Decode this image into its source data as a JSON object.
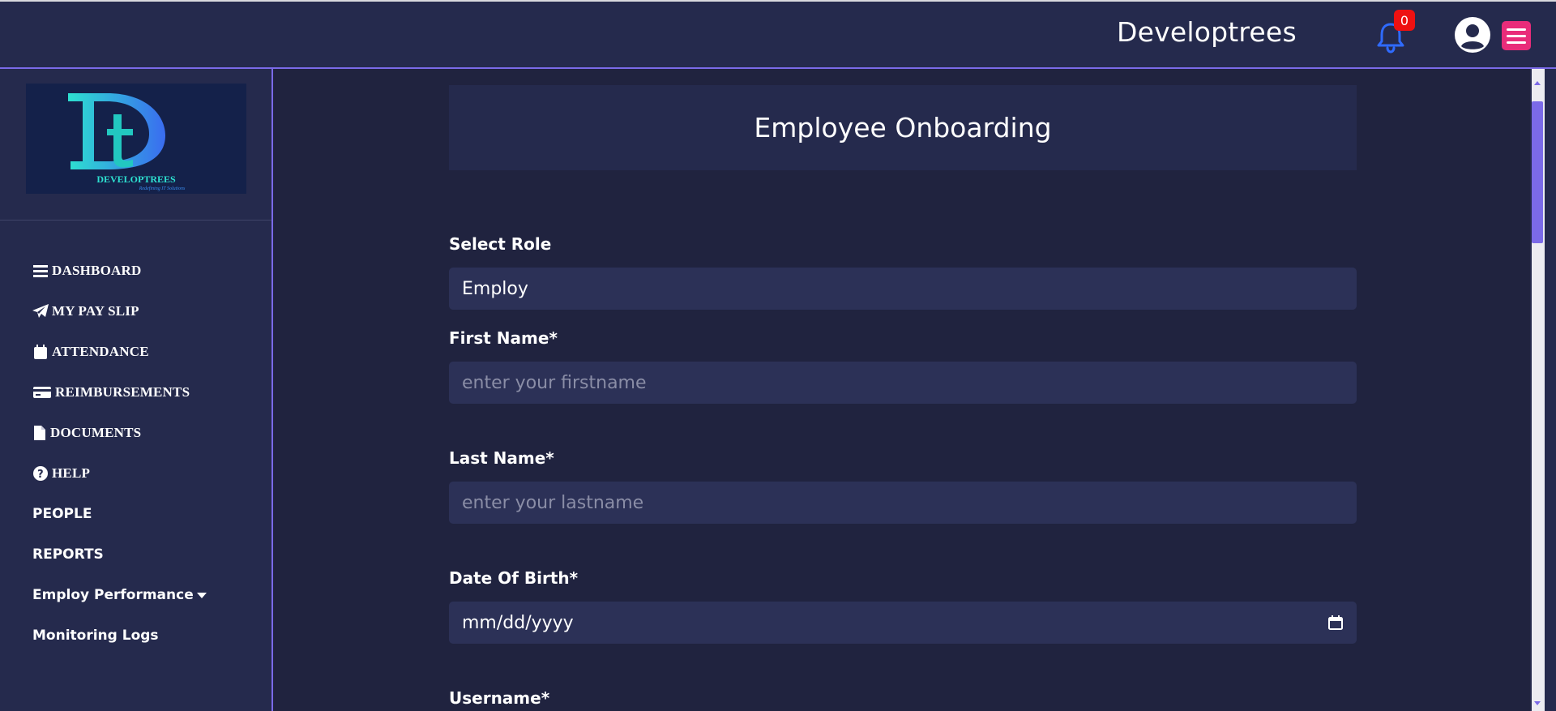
{
  "header": {
    "title": "Developtrees",
    "notification_count": "0",
    "bell_icon": "bell-icon",
    "avatar_icon": "user-circle-icon",
    "menu_icon": "hamburger-icon"
  },
  "logo": {
    "monogram": "Dt",
    "wordmark": "DEVELOPTREES",
    "tagline": "Redefining IT Solutions"
  },
  "sidebar": {
    "items": [
      {
        "label": "DASHBOARD",
        "icon": "bars-icon"
      },
      {
        "label": "MY PAY SLIP",
        "icon": "paper-plane-icon"
      },
      {
        "label": "ATTENDANCE",
        "icon": "calendar-icon"
      },
      {
        "label": "REIMBURSEMENTS",
        "icon": "credit-card-icon"
      },
      {
        "label": "DOCUMENTS",
        "icon": "file-icon"
      },
      {
        "label": "HELP",
        "icon": "question-circle-icon"
      },
      {
        "label": "PEOPLE"
      },
      {
        "label": "REPORTS"
      },
      {
        "label": "Employ Performance",
        "icon": "caret-down-icon"
      },
      {
        "label": "Monitoring Logs"
      }
    ]
  },
  "main": {
    "page_title": "Employee Onboarding",
    "form": {
      "role_label": "Select Role",
      "role_value": "Employ",
      "first_name_label": "First Name*",
      "first_name_placeholder": "enter your firstname",
      "last_name_label": "Last Name*",
      "last_name_placeholder": "enter your lastname",
      "dob_label": "Date Of Birth*",
      "dob_placeholder": "mm/dd/yyyy",
      "username_label": "Username*"
    }
  },
  "colors": {
    "accent": "#7b6ae8",
    "background": "#20233f",
    "panel": "#252a4d",
    "input": "#2c3157",
    "menu_button": "#e92c7a",
    "badge": "#ee1111",
    "bell": "#2f6bff"
  }
}
